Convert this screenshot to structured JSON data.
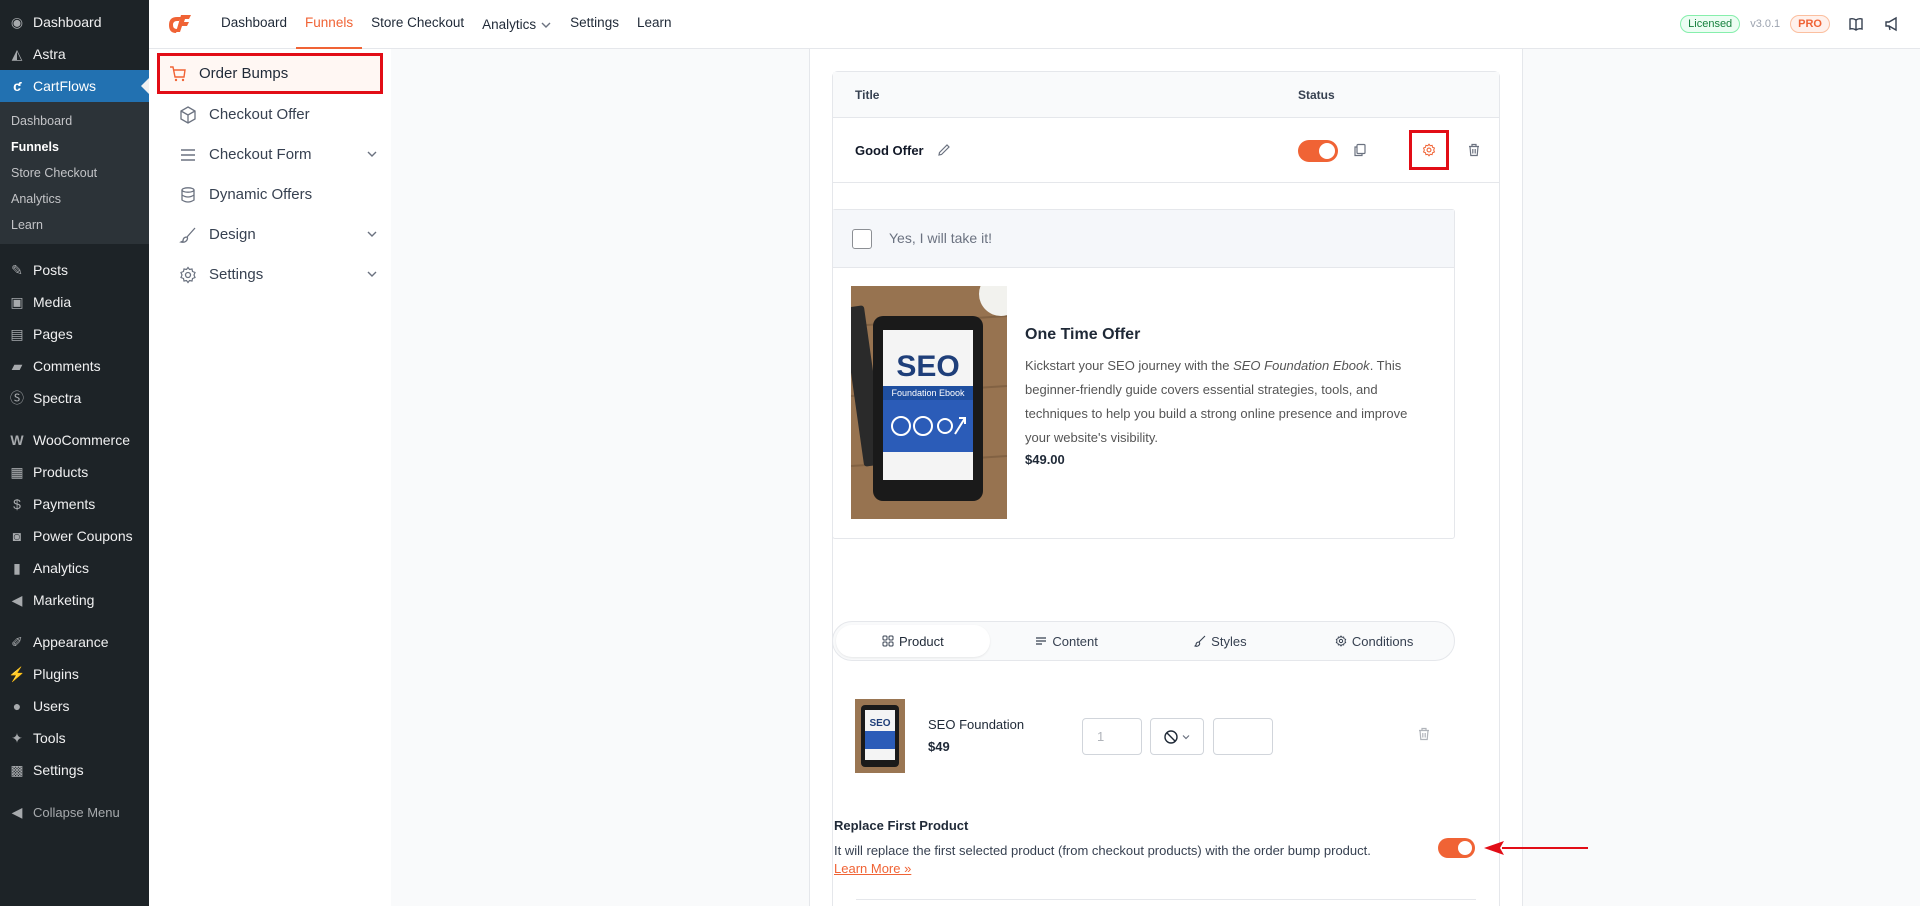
{
  "wp_sidebar": {
    "top_items": [
      {
        "label": "Dashboard",
        "icon": "dashboard-icon"
      },
      {
        "label": "Astra",
        "icon": "astra-icon"
      },
      {
        "label": "CartFlows",
        "icon": "cartflows-icon",
        "active": true
      }
    ],
    "cartflows_submenu": [
      "Dashboard",
      "Funnels",
      "Store Checkout",
      "Analytics",
      "Learn"
    ],
    "current_submenu": "Funnels",
    "group2": [
      "Posts",
      "Media",
      "Pages",
      "Comments",
      "Spectra"
    ],
    "group3": [
      "WooCommerce",
      "Products",
      "Payments",
      "Power Coupons",
      "Analytics",
      "Marketing"
    ],
    "group4": [
      "Appearance",
      "Plugins",
      "Users",
      "Tools",
      "Settings"
    ],
    "collapse_label": "Collapse Menu"
  },
  "topbar": {
    "nav": [
      "Dashboard",
      "Funnels",
      "Store Checkout",
      "Analytics",
      "Settings",
      "Learn"
    ],
    "active_nav": "Funnels",
    "licensed_label": "Licensed",
    "version": "v3.0.1",
    "pro_label": "PRO"
  },
  "settings_nav": [
    {
      "label": "Order Bumps",
      "icon": "cart-icon",
      "active": true
    },
    {
      "label": "Checkout Offer",
      "icon": "box-icon"
    },
    {
      "label": "Checkout Form",
      "icon": "lines-icon",
      "has_chevron": true
    },
    {
      "label": "Dynamic Offers",
      "icon": "database-icon"
    },
    {
      "label": "Design",
      "icon": "brush-icon",
      "has_chevron": true
    },
    {
      "label": "Settings",
      "icon": "gear-icon",
      "has_chevron": true
    }
  ],
  "table": {
    "col_title": "Title",
    "col_status": "Status",
    "offer_name": "Good Offer",
    "offer_enabled": true
  },
  "preview": {
    "cta": "Yes, I will take it!",
    "title": "One Time Offer",
    "desc_before": "Kickstart your SEO journey with the ",
    "desc_em": "SEO Foundation Ebook",
    "desc_after": ". This beginner-friendly guide covers essential strategies, tools, and techniques to help you build a strong online presence and improve your website's visibility.",
    "price": "$49.00",
    "image_text": {
      "big": "SEO",
      "small": "Foundation Ebook"
    }
  },
  "tabs": [
    {
      "label": "Product",
      "icon": "grid-icon",
      "active": true
    },
    {
      "label": "Content",
      "icon": "text-lines-icon"
    },
    {
      "label": "Styles",
      "icon": "brush-icon"
    },
    {
      "label": "Conditions",
      "icon": "gear-icon"
    }
  ],
  "product": {
    "name": "SEO Foundation",
    "price": "$49",
    "quantity_placeholder": "1",
    "image_text": "SEO"
  },
  "replace_first": {
    "label": "Replace First Product",
    "desc": "It will replace the first selected product (from checkout products) with the order bump product.",
    "learn_more": "Learn More »",
    "enabled": true
  },
  "colors": {
    "accent": "#f06335",
    "wp_sidebar_bg": "#1d2327",
    "wp_active": "#2271b1",
    "highlight_red": "#e20d16"
  }
}
